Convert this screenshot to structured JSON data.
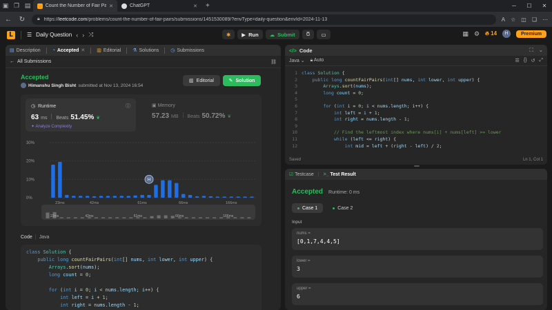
{
  "browser": {
    "tabs": [
      {
        "title": "Count the Number of Fair Pairs -",
        "active": true
      },
      {
        "title": "ChatGPT",
        "active": false
      }
    ],
    "url_prefix": "https://",
    "url_host": "leetcode.com",
    "url_path": "/problems/count-the-number-of-fair-pairs/submissions/1451530089/?envType=daily-question&envId=2024-11-13"
  },
  "header": {
    "daily_label": "Daily Question",
    "run_label": "Run",
    "submit_label": "Submit",
    "streak": "14",
    "avatar_initial": "H",
    "premium_label": "Premium"
  },
  "left": {
    "tabs": [
      "Description",
      "Accepted",
      "Editorial",
      "Solutions",
      "Submissions"
    ],
    "all_submissions": "All Submissions",
    "status": "Accepted",
    "author": "Himanshu Singh Bisht",
    "submitted": "submitted at Nov 13, 2024 16:54",
    "editorial_btn": "Editorial",
    "solution_btn": "Solution",
    "runtime": {
      "title": "Runtime",
      "value": "63",
      "unit": "ms",
      "beats_label": "Beats",
      "beats": "51.45%",
      "analyze": "Analyze Complexity"
    },
    "memory": {
      "title": "Memory",
      "value": "57.23",
      "unit": "MB",
      "beats_label": "Beats",
      "beats": "50.72%"
    },
    "code_label": "Code",
    "code_lang": "Java",
    "code_lines": [
      "class Solution {",
      "    public long countFairPairs(int[] nums, int lower, int upper) {",
      "        Arrays.sort(nums);",
      "        long count = 0;",
      "",
      "        for (int i = 0; i < nums.length; i++) {",
      "            int left = i + 1;",
      "            int right = nums.length - 1;"
    ]
  },
  "chart_data": {
    "type": "bar",
    "y_ticks": [
      "30%",
      "20%",
      "10%",
      "0%"
    ],
    "ylim": [
      0,
      30
    ],
    "x_tick_labels": [
      "23ms",
      "42ms",
      "61ms",
      "66ms",
      "166ms"
    ],
    "values": [
      18,
      19.5,
      1.5,
      1,
      1,
      1,
      0.8,
      1,
      1,
      1,
      1,
      1,
      1.2,
      1.5,
      1.5,
      7,
      9.5,
      9.5,
      8,
      2,
      1.5,
      0.8,
      1,
      0.8,
      0.6,
      0.6,
      0.6,
      0.6,
      0.6,
      0.6
    ],
    "highlight_index": 15,
    "highlight_label": "H",
    "bar_color": "#1e6fe6",
    "overview_labels": [
      "23ms",
      "42ms",
      "61ms",
      "66ms",
      "166ms"
    ]
  },
  "editor": {
    "title": "Code",
    "lang": "Java",
    "mode": "Auto",
    "lines": [
      {
        "n": "1",
        "code": "class Solution {"
      },
      {
        "n": "2",
        "code": "    public long countFairPairs(int[] nums, int lower, int upper) {"
      },
      {
        "n": "3",
        "code": "        Arrays.sort(nums);"
      },
      {
        "n": "4",
        "code": "        long count = 0;"
      },
      {
        "n": "5",
        "code": ""
      },
      {
        "n": "6",
        "code": "        for (int i = 0; i < nums.length; i++) {"
      },
      {
        "n": "7",
        "code": "            int left = i + 1;"
      },
      {
        "n": "8",
        "code": "            int right = nums.length - 1;"
      },
      {
        "n": "9",
        "code": ""
      },
      {
        "n": "10",
        "code": "            // Find the leftmost index where nums[i] + nums[left] >= lower"
      },
      {
        "n": "11",
        "code": "            while (left <= right) {"
      },
      {
        "n": "12",
        "code": "                int mid = left + (right - left) / 2;"
      }
    ],
    "saved": "Saved",
    "cursor": "Ln 1, Col 1"
  },
  "testpanel": {
    "tab1": "Testcase",
    "tab2": "Test Result",
    "status": "Accepted",
    "runtime": "Runtime: 0 ms",
    "case1": "Case 1",
    "case2": "Case 2",
    "input_label": "Input",
    "vars": [
      {
        "name": "nums =",
        "value": "[0,1,7,4,4,5]"
      },
      {
        "name": "lower =",
        "value": "3"
      },
      {
        "name": "upper =",
        "value": "6"
      }
    ]
  }
}
